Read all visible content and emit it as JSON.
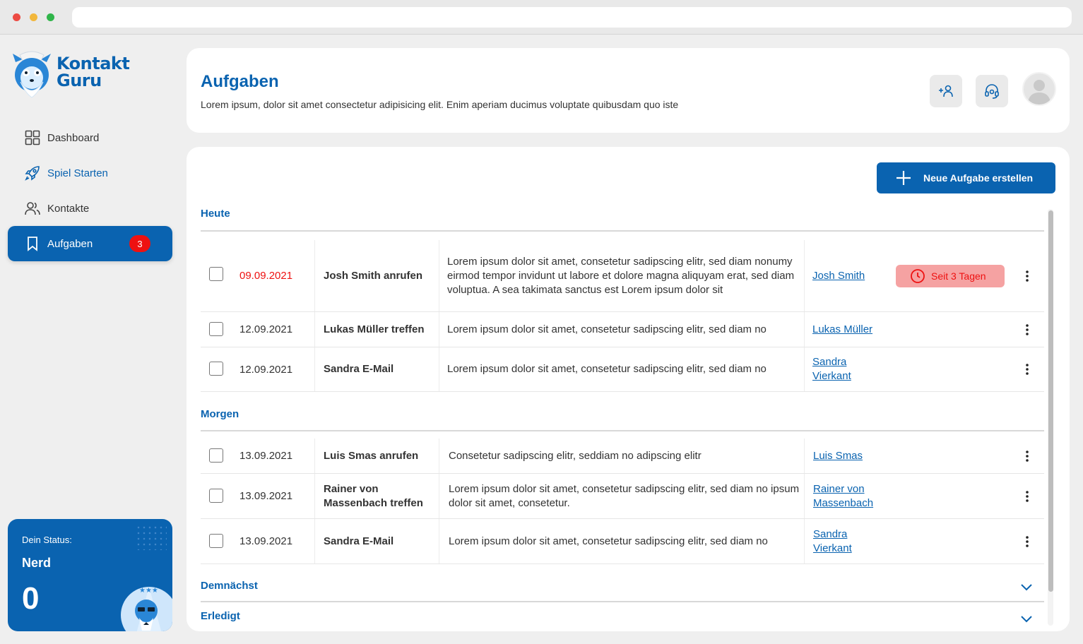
{
  "brand": {
    "name_line1": "Kontakt",
    "name_line2": "Guru",
    "color": "#0a63b0"
  },
  "sidebar": {
    "items": [
      {
        "label": "Dashboard",
        "icon": "grid-icon"
      },
      {
        "label": "Spiel Starten",
        "icon": "rocket-icon"
      },
      {
        "label": "Kontakte",
        "icon": "users-icon"
      },
      {
        "label": "Aufgaben",
        "icon": "bookmark-icon",
        "badge": "3"
      }
    ]
  },
  "status": {
    "label": "Dein Status:",
    "name": "Nerd",
    "score": "0"
  },
  "header": {
    "title": "Aufgaben",
    "subtitle": "Lorem ipsum, dolor sit amet consectetur adipisicing elit. Enim aperiam ducimus voluptate quibusdam quo iste",
    "add_contact_icon": "add-user-icon",
    "support_icon": "headset-icon"
  },
  "actions": {
    "new_task_label": "Neue Aufgabe erstellen"
  },
  "sections": {
    "today": {
      "title": "Heute",
      "rows": [
        {
          "date": "09.09.2021",
          "title": "Josh Smith anrufen",
          "desc": "Lorem ipsum dolor sit amet, consetetur sadipscing elitr, sed diam nonumy eirmod tempor invidunt ut labore et dolore magna aliquyam erat, sed diam voluptua. A sea takimata sanctus est Lorem ipsum dolor sit",
          "contact": "Josh Smith",
          "badge": "Seit 3 Tagen"
        },
        {
          "date": "12.09.2021",
          "title": "Lukas Müller treffen",
          "desc": "Lorem ipsum dolor sit amet, consetetur sadipscing elitr, sed diam no",
          "contact": "Lukas Müller"
        },
        {
          "date": "12.09.2021",
          "title": "Sandra E-Mail",
          "desc": "Lorem ipsum dolor sit amet, consetetur sadipscing elitr, sed diam no",
          "contact": "Sandra Vierkant"
        }
      ]
    },
    "tomorrow": {
      "title": "Morgen",
      "rows": [
        {
          "date": "13.09.2021",
          "title": "Luis Smas anrufen",
          "desc": "Consetetur sadipscing elitr, seddiam no adipscing elitr",
          "contact": "Luis Smas"
        },
        {
          "date": "13.09.2021",
          "title": "Rainer von Massenbach treffen",
          "desc": "Lorem ipsum dolor sit amet, consetetur sadipscing elitr, sed diam no ipsum dolor sit amet, consetetur.",
          "contact": "Rainer von Massenbach"
        },
        {
          "date": "13.09.2021",
          "title": "Sandra E-Mail",
          "desc": "Lorem ipsum dolor sit amet, consetetur sadipscing elitr, sed diam no",
          "contact": "Sandra Vierkant"
        }
      ]
    },
    "upcoming": {
      "title": "Demnächst"
    },
    "done": {
      "title": "Erledigt"
    }
  },
  "colors": {
    "accent": "#0a63b0",
    "overdue": "#ee1111",
    "overdue_bg": "#f5a2a2"
  }
}
